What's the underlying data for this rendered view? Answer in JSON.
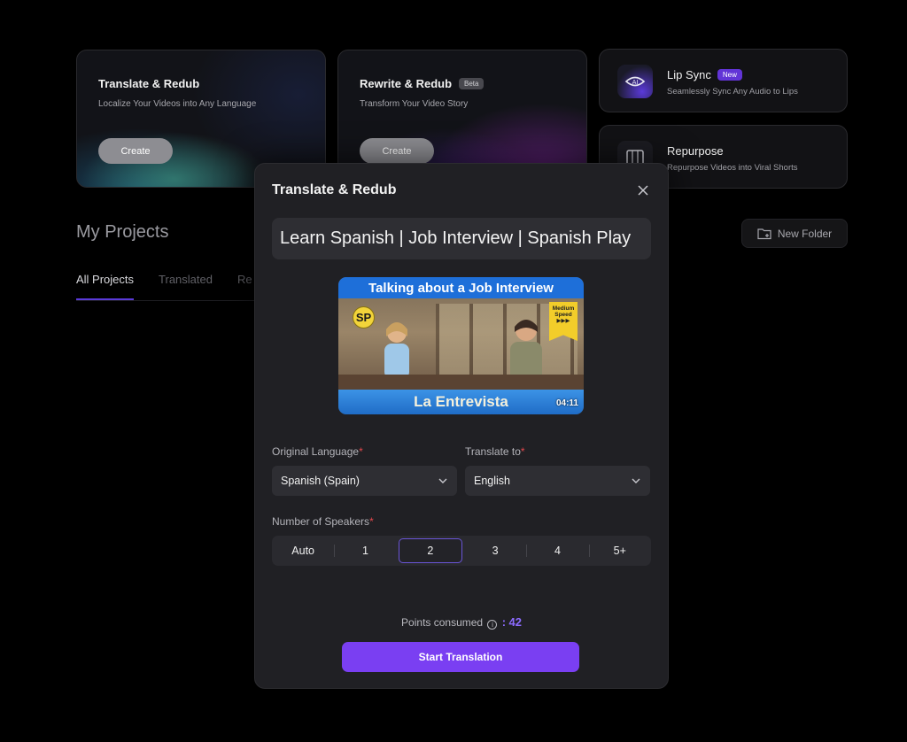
{
  "cards": {
    "translate": {
      "title": "Translate & Redub",
      "subtitle": "Localize Your Videos into Any Language",
      "button": "Create"
    },
    "rewrite": {
      "title": "Rewrite & Redub",
      "badge": "Beta",
      "subtitle": "Transform Your Video Story",
      "button": "Create"
    },
    "lipsync": {
      "title": "Lip Sync",
      "badge": "New",
      "subtitle": "Seamlessly Sync Any Audio to Lips"
    },
    "repurpose": {
      "title": "Repurpose",
      "subtitle": "Repurpose Videos into Viral Shorts"
    }
  },
  "projects": {
    "title": "My Projects",
    "tabs": [
      "All Projects",
      "Translated",
      "Re"
    ],
    "new_folder": "New Folder"
  },
  "modal": {
    "title": "Translate & Redub",
    "video_title": "Learn Spanish | Job Interview | Spanish Play",
    "thumbnail": {
      "banner": "Talking about a Job Interview",
      "footer": "La Entrevista",
      "badge": "SP",
      "speed_line1": "Medium",
      "speed_line2": "Speed",
      "duration": "04:11"
    },
    "original_language": {
      "label": "Original Language",
      "value": "Spanish (Spain)"
    },
    "translate_to": {
      "label": "Translate to",
      "value": "English"
    },
    "speakers": {
      "label": "Number of Speakers",
      "options": [
        "Auto",
        "1",
        "2",
        "3",
        "4",
        "5+"
      ],
      "selected": "2"
    },
    "points": {
      "label": "Points consumed",
      "separator": ":",
      "value": "42"
    },
    "start_button": "Start Translation"
  },
  "colors": {
    "accent": "#7a3ff2",
    "required": "#e5484d",
    "points": "#8c6bff"
  }
}
